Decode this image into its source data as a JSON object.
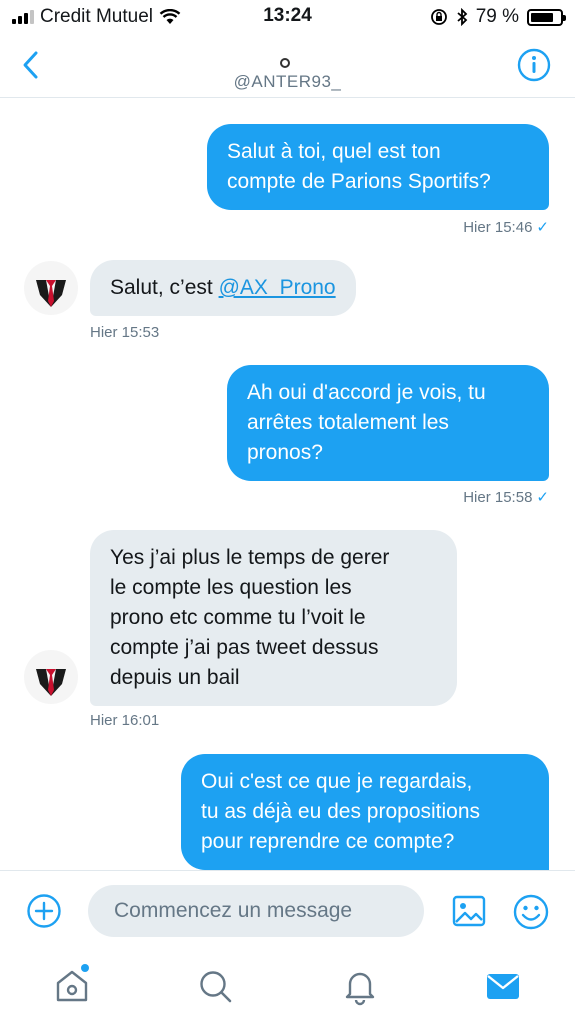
{
  "status": {
    "carrier": "Credit Mutuel",
    "time": "13:24",
    "battery": "79 %",
    "battery_level": 0.79
  },
  "header": {
    "handle": "@ANTER93_"
  },
  "messages": [
    {
      "direction": "outgoing",
      "lines": [
        "Salut à toi, quel est ton",
        "compte de Parions Sportifs?"
      ],
      "timestamp": "Hier 15:46",
      "check": "✓"
    },
    {
      "direction": "incoming",
      "text_prefix": "Salut, c’est ",
      "mention": "@AX_Prono",
      "timestamp": "Hier 15:53"
    },
    {
      "direction": "outgoing",
      "lines": [
        "Ah oui d'accord je vois, tu",
        "arrêtes totalement les",
        "pronos?"
      ],
      "timestamp": "Hier 15:58",
      "check": "✓"
    },
    {
      "direction": "incoming",
      "lines": [
        "Yes j’ai plus le temps de gerer",
        "le compte les question les",
        "prono etc comme tu l’voit le",
        "compte j’ai pas tweet dessus",
        "depuis un bail"
      ],
      "timestamp": "Hier 16:01"
    },
    {
      "direction": "outgoing",
      "lines": [
        "Oui c'est ce que je regardais,",
        "tu as déjà eu des propositions",
        "pour reprendre ce compte?"
      ]
    }
  ],
  "composer": {
    "placeholder": "Commencez un message"
  },
  "colors": {
    "accent": "#1da1f2",
    "incoming_bubble": "#e6ecf0",
    "secondary_text": "#657786"
  },
  "icons": {
    "back": "chevron-left-icon",
    "info": "info-icon",
    "add": "plus-circle-icon",
    "image": "image-icon",
    "emoji": "emoji-icon",
    "tabs": [
      "home-icon",
      "search-icon",
      "bell-icon",
      "mail-icon"
    ]
  }
}
